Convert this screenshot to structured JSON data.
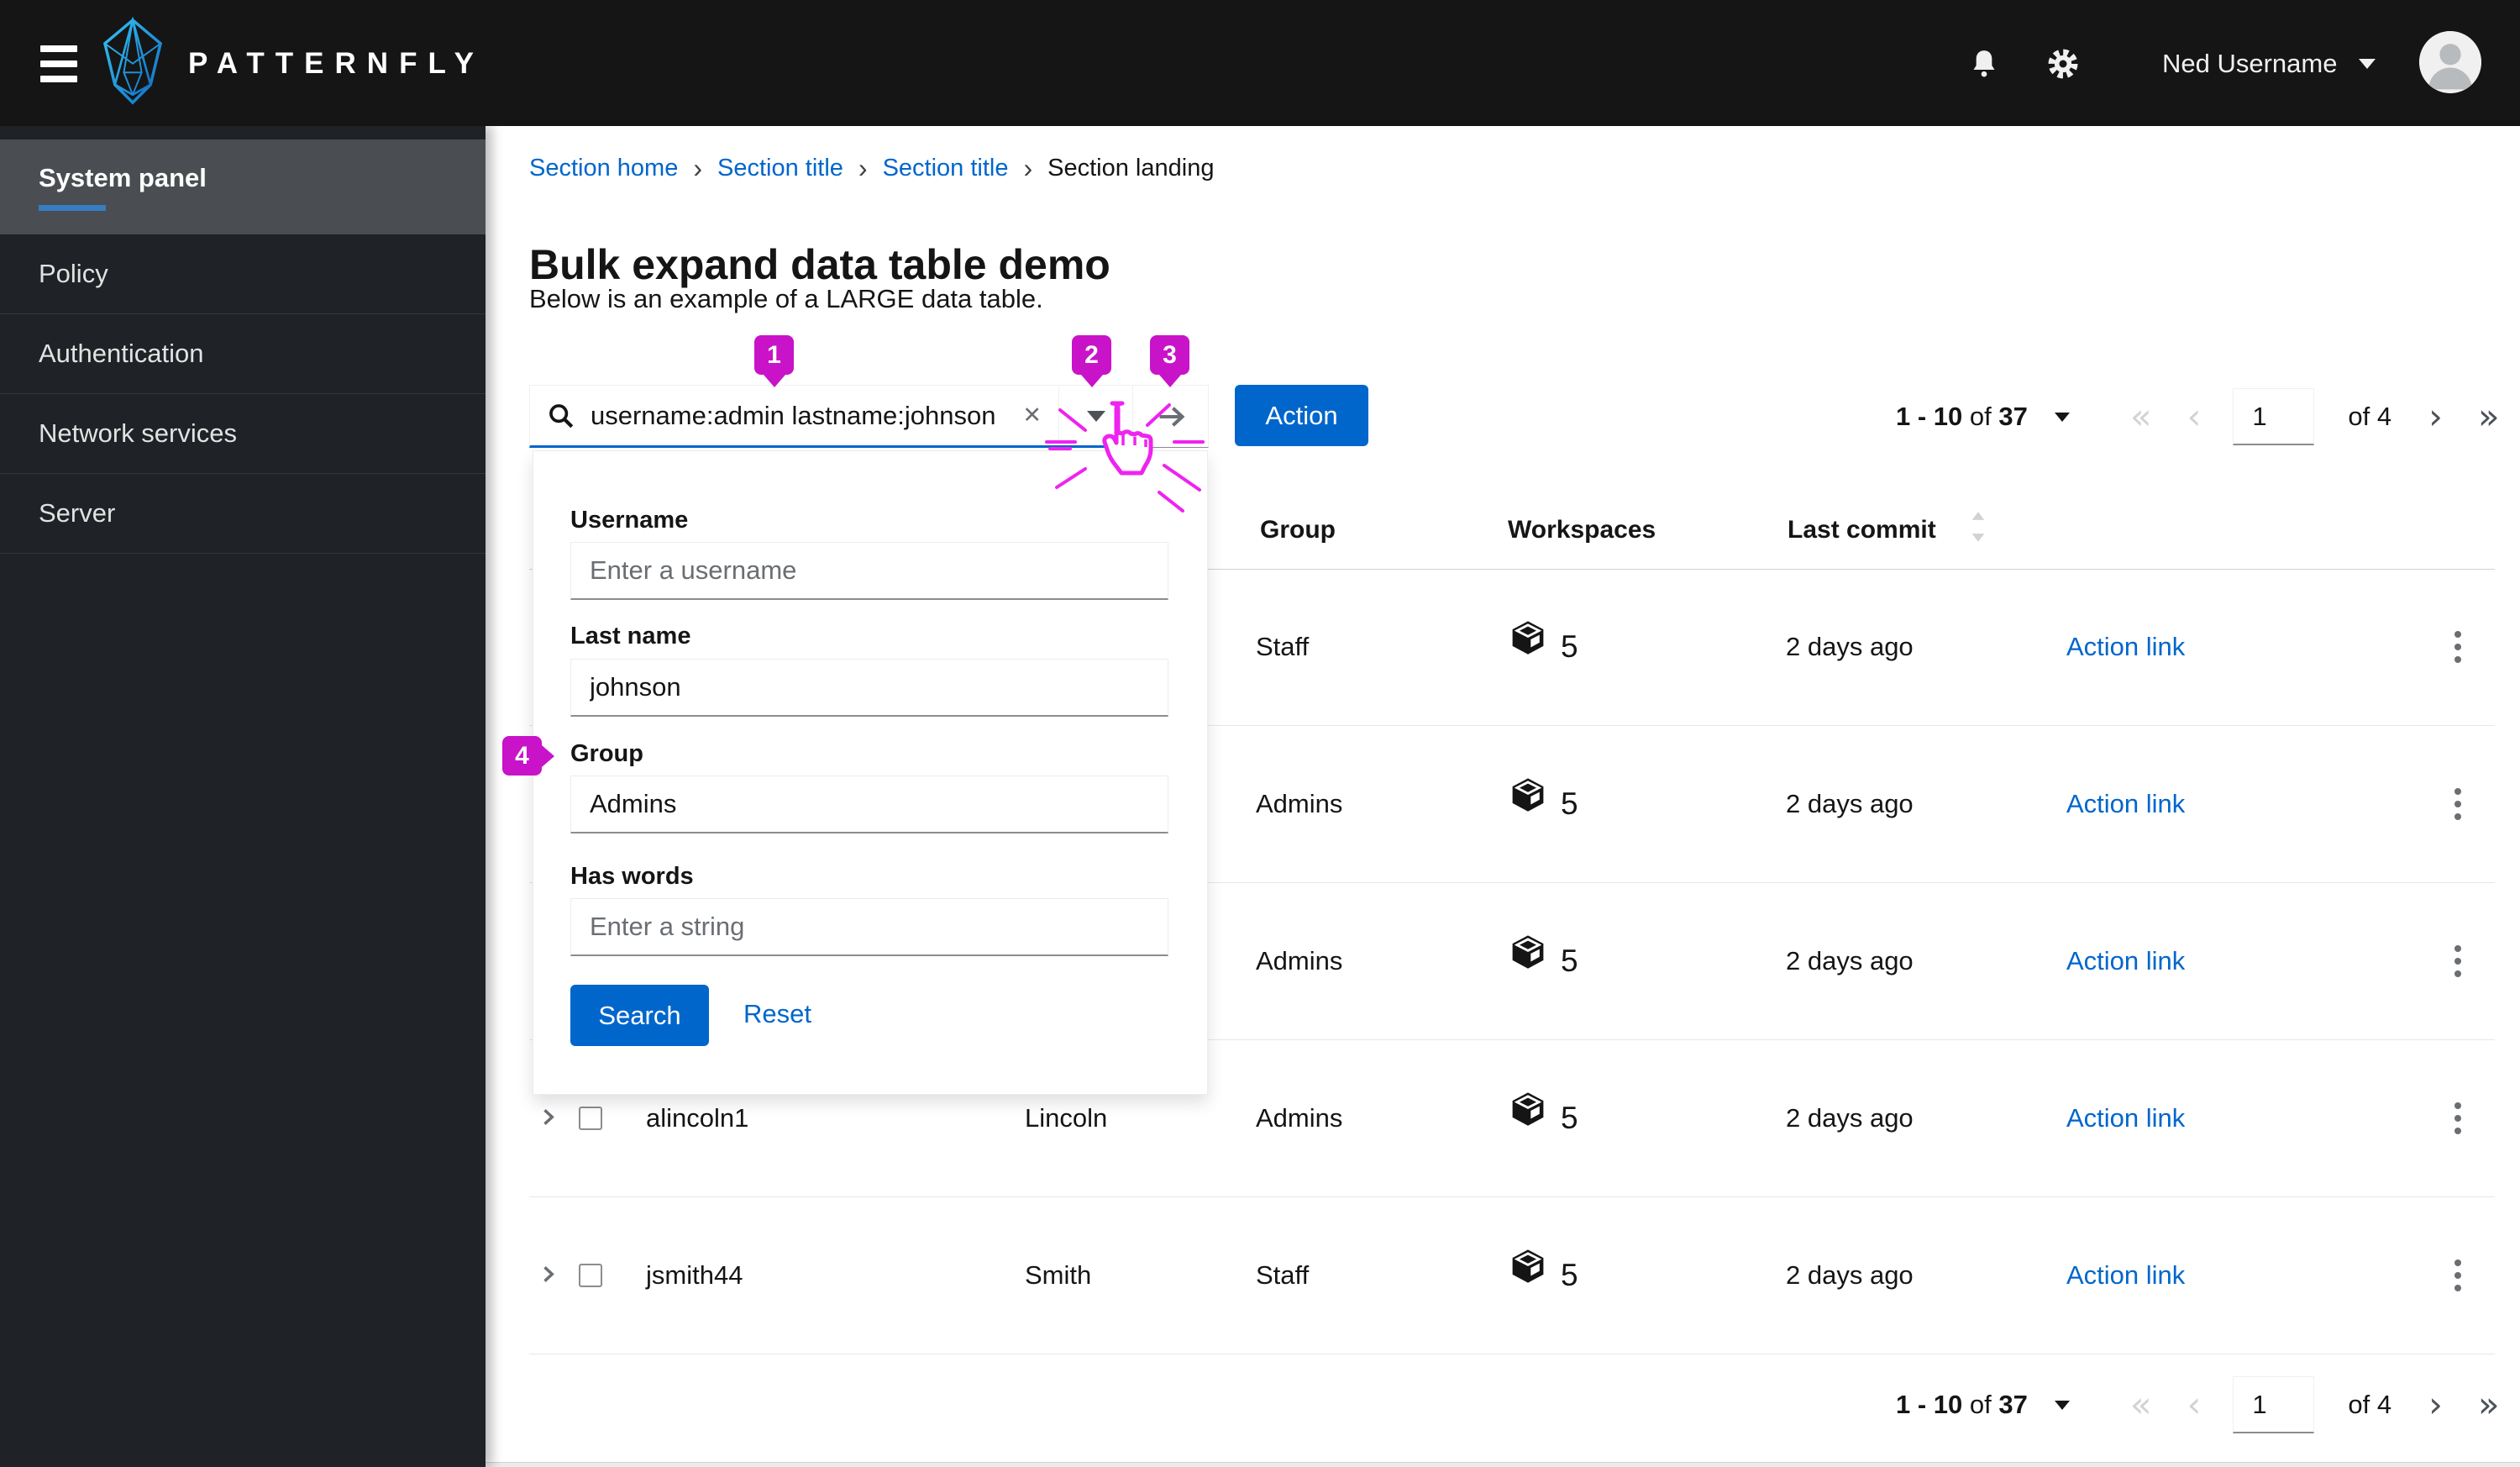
{
  "masthead": {
    "brand": "PATTERNFLY",
    "user_name": "Ned Username"
  },
  "sidebar": {
    "items": [
      {
        "label": "System panel",
        "active": true
      },
      {
        "label": "Policy",
        "active": false
      },
      {
        "label": "Authentication",
        "active": false
      },
      {
        "label": "Network services",
        "active": false
      },
      {
        "label": "Server",
        "active": false
      }
    ]
  },
  "breadcrumb": {
    "items": [
      {
        "label": "Section home"
      },
      {
        "label": "Section title"
      },
      {
        "label": "Section title"
      },
      {
        "label": "Section landing"
      }
    ]
  },
  "page": {
    "title": "Bulk expand data table demo",
    "subtitle": "Below is an example of a LARGE data table."
  },
  "toolbar": {
    "search_value": "username:admin lastname:johnson",
    "action_label": "Action"
  },
  "advanced_search": {
    "username_label": "Username",
    "username_placeholder": "Enter a username",
    "lastname_label": "Last name",
    "lastname_value": "johnson",
    "group_label": "Group",
    "group_value": "Admins",
    "haswords_label": "Has words",
    "haswords_placeholder": "Enter a string",
    "search_label": "Search",
    "reset_label": "Reset"
  },
  "pagination": {
    "range": "1 - 10",
    "of_word": "of",
    "total": "37",
    "page_value": "1",
    "of_pages": "of 4"
  },
  "table": {
    "headers": {
      "group": "Group",
      "workspaces": "Workspaces",
      "last_commit": "Last commit"
    },
    "rows": [
      {
        "username": "",
        "lastname": "",
        "group": "Staff",
        "workspaces": "5",
        "last_commit": "2 days ago",
        "action": "Action link"
      },
      {
        "username": "",
        "lastname": "",
        "group": "Admins",
        "workspaces": "5",
        "last_commit": "2 days ago",
        "action": "Action link"
      },
      {
        "username": "",
        "lastname": "",
        "group": "Admins",
        "workspaces": "5",
        "last_commit": "2 days ago",
        "action": "Action link"
      },
      {
        "username": "alincoln1",
        "lastname": "Lincoln",
        "group": "Admins",
        "workspaces": "5",
        "last_commit": "2 days ago",
        "action": "Action link"
      },
      {
        "username": "jsmith44",
        "lastname": "Smith",
        "group": "Staff",
        "workspaces": "5",
        "last_commit": "2 days ago",
        "action": "Action link"
      }
    ]
  },
  "annotations": {
    "badge1": "1",
    "badge2": "2",
    "badge3": "3",
    "badge4": "4",
    "accent_color": "#c913c9"
  },
  "colors": {
    "primary": "#0066cc",
    "masthead_bg": "#151515",
    "sidebar_bg": "#1f2226",
    "active_nav_underline": "#377dc3"
  }
}
